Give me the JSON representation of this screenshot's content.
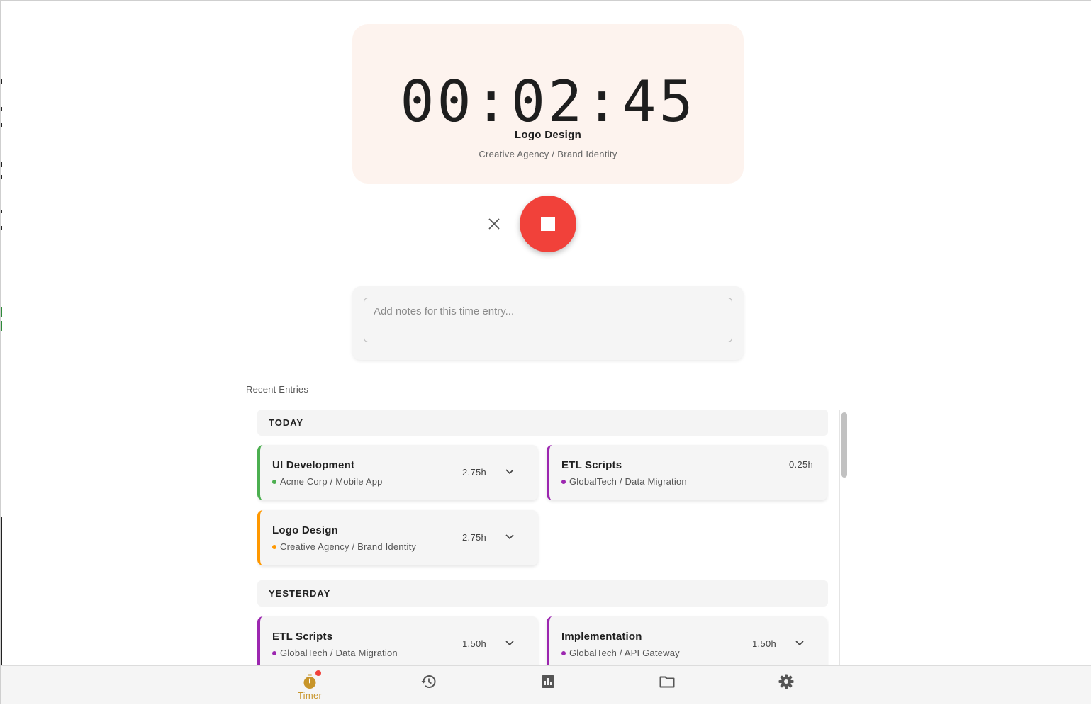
{
  "timer": {
    "elapsed": "00:02:45",
    "task": "Logo Design",
    "path": "Creative Agency / Brand Identity"
  },
  "controls": {
    "discard_icon": "close-icon",
    "stop_icon": "stop-icon"
  },
  "notes": {
    "placeholder": "Add notes for this time entry...",
    "value": ""
  },
  "recent": {
    "title": "Recent Entries",
    "groups": [
      {
        "label": "TODAY",
        "entries": [
          {
            "title": "UI Development",
            "path": "Acme Corp / Mobile App",
            "hours": "2.75h",
            "color": "#4caf50",
            "expandable": true
          },
          {
            "title": "ETL Scripts",
            "path": "GlobalTech / Data Migration",
            "hours": "0.25h",
            "color": "#9c27b0",
            "expandable": false
          },
          {
            "title": "Logo Design",
            "path": "Creative Agency / Brand Identity",
            "hours": "2.75h",
            "color": "#ff9800",
            "expandable": true
          }
        ]
      },
      {
        "label": "YESTERDAY",
        "entries": [
          {
            "title": "ETL Scripts",
            "path": "GlobalTech / Data Migration",
            "hours": "1.50h",
            "color": "#9c27b0",
            "expandable": true
          },
          {
            "title": "Implementation",
            "path": "GlobalTech / API Gateway",
            "hours": "1.50h",
            "color": "#9c27b0",
            "expandable": true
          }
        ]
      }
    ]
  },
  "nav": {
    "active_color": "#c8952a",
    "items": [
      {
        "icon": "timer-icon",
        "label": "Timer",
        "active": true,
        "badge": true
      },
      {
        "icon": "history-icon",
        "label": "",
        "active": false
      },
      {
        "icon": "reports-icon",
        "label": "",
        "active": false
      },
      {
        "icon": "folder-icon",
        "label": "",
        "active": false
      },
      {
        "icon": "settings-icon",
        "label": "",
        "active": false
      }
    ]
  }
}
